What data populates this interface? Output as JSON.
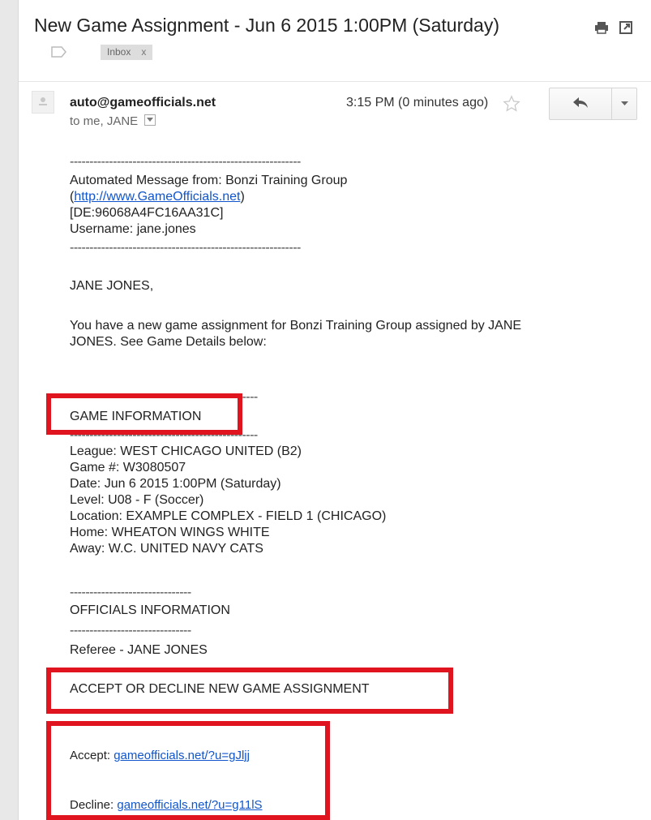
{
  "email": {
    "subject": "New Game Assignment - Jun 6 2015 1:00PM (Saturday)",
    "label": "Inbox",
    "label_remove": "x",
    "from": "auto@gameofficials.net",
    "to_line": "to me, JANE",
    "time": "3:15 PM (0 minutes ago)"
  },
  "body": {
    "divider_long": "-----------------------------------------------------------",
    "automated_from": "Automated Message from: Bonzi Training Group",
    "link_open": "(",
    "link_text": "http://www.GameOfficials.net",
    "link_close": ")",
    "de_code": "[DE:96068A4FC16AA31C]",
    "username": "Username: jane.jones",
    "salutation": "JANE JONES,",
    "intro_line1": "You have a new game assignment for Bonzi Training Group assigned by JANE",
    "intro_line2": "JONES. See Game Details below:",
    "game_info_divider": "------------------------------------------------",
    "game_info_header": "GAME INFORMATION",
    "league": "League: WEST CHICAGO UNITED (B2)",
    "game_num": "Game #: W3080507",
    "date": "Date: Jun  6 2015  1:00PM (Saturday)",
    "level": "Level: U08 - F (Soccer)",
    "location": "Location: EXAMPLE COMPLEX - FIELD 1 (CHICAGO)",
    "home": "Home: WHEATON WINGS WHITE",
    "away": "Away: W.C. UNITED NAVY CATS",
    "officials_divider": "-------------------------------",
    "officials_header": "OFFICIALS INFORMATION",
    "referee": "Referee - JANE JONES",
    "accept_divider": "-------------------------------------------------------------------------------",
    "accept_header": "ACCEPT OR DECLINE NEW GAME ASSIGNMENT",
    "accept_label": "Accept:",
    "accept_link": "gameofficials.net/?u=gJljj",
    "decline_label": "Decline:",
    "decline_link": "gameofficials.net/?u=g11lS"
  },
  "colors": {
    "highlight": "#e0141e",
    "link": "#1155cc"
  },
  "icons": [
    "print-icon",
    "new-window-icon",
    "label-tag-icon",
    "avatar",
    "star-icon",
    "reply-icon",
    "more-options-icon",
    "dropdown-icon"
  ]
}
